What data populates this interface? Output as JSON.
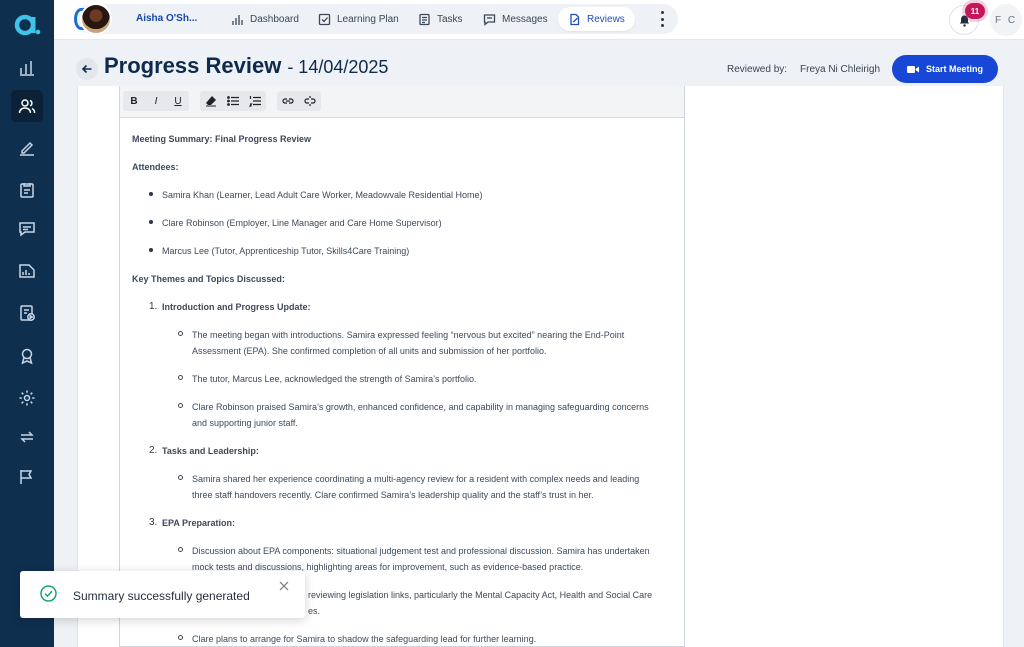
{
  "sidebar": {
    "logo": "brand-logo",
    "items": [
      {
        "name": "sidebar-item-analytics",
        "icon": "bar-chart-icon"
      },
      {
        "name": "sidebar-item-users",
        "icon": "users-icon",
        "active": true
      },
      {
        "name": "sidebar-item-edit",
        "icon": "pen-icon"
      },
      {
        "name": "sidebar-item-tasks",
        "icon": "clipboard-icon"
      },
      {
        "name": "sidebar-item-messages",
        "icon": "chat-icon"
      },
      {
        "name": "sidebar-item-reports",
        "icon": "report-icon"
      },
      {
        "name": "sidebar-item-media",
        "icon": "play-document-icon"
      },
      {
        "name": "sidebar-item-awards",
        "icon": "award-icon"
      },
      {
        "name": "sidebar-item-settings",
        "icon": "gear-icon"
      },
      {
        "name": "sidebar-item-sync",
        "icon": "sync-icon"
      },
      {
        "name": "sidebar-item-flags",
        "icon": "flag-icon"
      }
    ]
  },
  "topnav": {
    "user_name": "Aisha O'Sh...",
    "items": [
      {
        "label": "Dashboard",
        "icon": "bar-chart-icon"
      },
      {
        "label": "Learning Plan",
        "icon": "checkbox-icon"
      },
      {
        "label": "Tasks",
        "icon": "document-icon"
      },
      {
        "label": "Messages",
        "icon": "chat-icon"
      },
      {
        "label": "Reviews",
        "icon": "review-icon",
        "active": true
      }
    ],
    "notifications_count": "11",
    "user_initials": "F C"
  },
  "header": {
    "title": "Progress Review",
    "date": "- 14/04/2025",
    "reviewed_by_label": "Reviewed by:",
    "reviewer_name": "Freya Ni Chleirigh",
    "start_meeting_label": "Start Meeting"
  },
  "editor": {
    "toolbar": [
      "B",
      "I",
      "U"
    ],
    "content": {
      "heading": "Meeting Summary: Final Progress Review",
      "attendees_label": "Attendees:",
      "attendees": [
        "Samira Khan (Learner, Lead Adult Care Worker, Meadowvale Residential Home)",
        "Clare Robinson (Employer, Line Manager and Care Home Supervisor)",
        "Marcus Lee (Tutor, Apprenticeship Tutor, Skills4Care Training)"
      ],
      "themes_label": "Key Themes and Topics Discussed:",
      "sections": [
        {
          "number": "1.",
          "title": "Introduction and Progress Update:",
          "points": [
            [
              "The meeting began with introductions. Samira expressed feeling “nervous but excited” nearing the End-Point",
              "Assessment (EPA). She confirmed completion of all units and submission of her portfolio."
            ],
            [
              "The tutor, Marcus Lee, acknowledged the strength of Samira’s portfolio."
            ],
            [
              "Clare Robinson praised Samira’s growth, enhanced confidence, and capability in managing safeguarding concerns",
              "and supporting junior staff."
            ]
          ]
        },
        {
          "number": "2.",
          "title": "Tasks and Leadership:",
          "points": [
            [
              "Samira shared her experience coordinating a multi-agency review for a resident with complex needs and leading",
              "three staff handovers recently. Clare confirmed Samira’s leadership quality and the staff’s trust in her."
            ]
          ]
        },
        {
          "number": "3.",
          "title": "EPA Preparation:",
          "points": [
            [
              "Discussion about EPA components: situational judgement test and professional discussion. Samira has undertaken",
              "mock tests and discussions, highlighting areas for improvement, such as evidence-based practice."
            ],
            [
              "reviewing legislation links, particularly the Mental Capacity Act, Health and Social Care",
              "es."
            ],
            [
              "Clare plans to arrange for Samira to shadow the safeguarding lead for further learning."
            ]
          ]
        }
      ]
    }
  },
  "toast": {
    "message": "Summary successfully generated",
    "icon": "check-circle-icon"
  },
  "colors": {
    "sidebar": "#0f2f4f",
    "primary": "#1747d6",
    "badge": "#c2185b"
  }
}
